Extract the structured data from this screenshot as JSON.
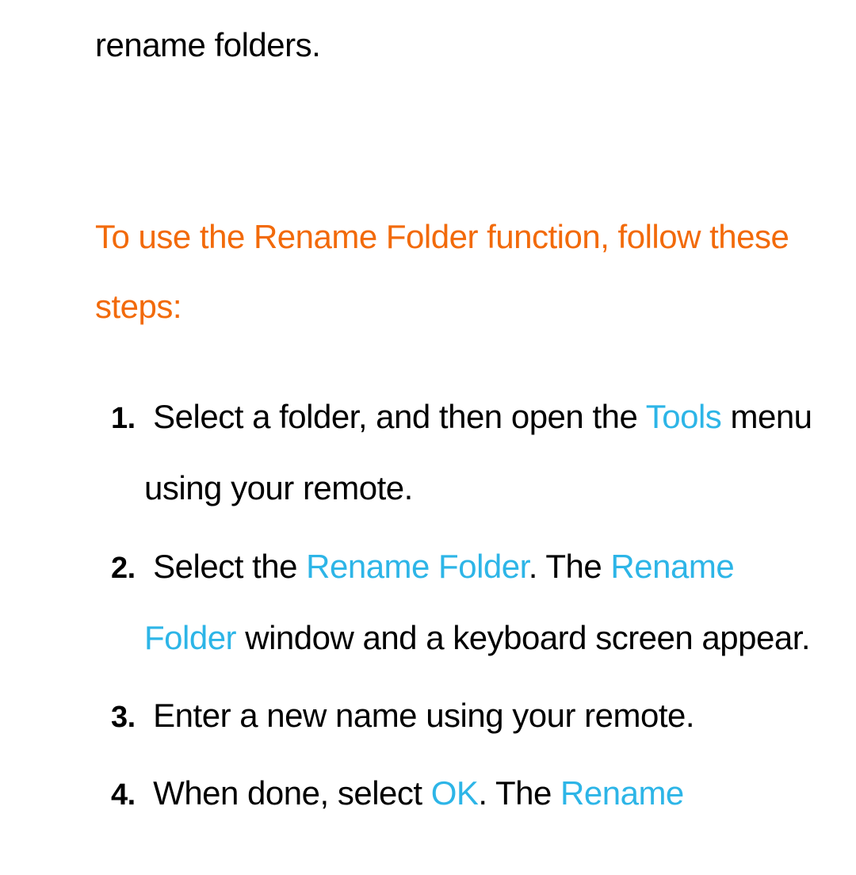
{
  "intro": "rename folders.",
  "heading": "To use the Rename Folder function, follow these steps:",
  "steps": [
    {
      "pre": "Select a folder, and then open the ",
      "hl1": "Tools",
      "post": " menu using your remote."
    },
    {
      "pre": "Select the ",
      "hl1": "Rename Folder",
      "mid1": ". The ",
      "hl2": "Rename Folder",
      "post": " window and a keyboard screen appear."
    },
    {
      "pre": "Enter a new name using your remote."
    },
    {
      "pre": "When done, select ",
      "hl1": "OK",
      "mid1": ". The ",
      "hl2": "Rename"
    }
  ]
}
